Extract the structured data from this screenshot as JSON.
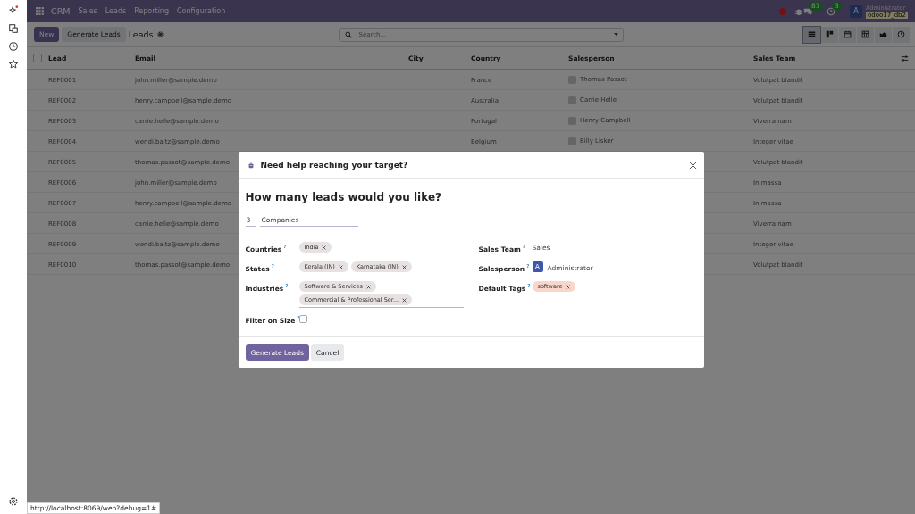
{
  "navbar": {
    "app": "CRM",
    "menus": [
      "Sales",
      "Leads",
      "Reporting",
      "Configuration"
    ],
    "messages_count": "83",
    "activities_count": "3",
    "user_initial": "A",
    "user_name": "Administrator",
    "database": "odoo17_db2"
  },
  "control_panel": {
    "new_button": "New",
    "generate_button": "Generate Leads",
    "breadcrumb": "Leads",
    "search": {
      "placeholder": "Search..."
    },
    "views": [
      {
        "kind": "list",
        "selected": true
      },
      {
        "kind": "kanban",
        "selected": false
      },
      {
        "kind": "calendar",
        "selected": false
      },
      {
        "kind": "pivot",
        "selected": false
      },
      {
        "kind": "graph",
        "selected": false
      },
      {
        "kind": "activity",
        "selected": false
      }
    ]
  },
  "table": {
    "select_all_checked": false,
    "columns": [
      "Lead",
      "Email",
      "City",
      "Country",
      "Salesperson",
      "Sales Team"
    ],
    "rows": [
      {
        "lead": "REF0001",
        "email": "john.miller@sample.demo",
        "country": "France",
        "salesperson": "Thomas Passot",
        "team": "Volutpat blandit"
      },
      {
        "lead": "REF0002",
        "email": "henry.campbell@sample.demo",
        "country": "Australia",
        "salesperson": "Carrie Helle",
        "team": "Volutpat blandit"
      },
      {
        "lead": "REF0003",
        "email": "carrie.helle@sample.demo",
        "country": "Portugal",
        "salesperson": "Henry Campbell",
        "team": "Viverra nam"
      },
      {
        "lead": "REF0004",
        "email": "wendi.baltz@sample.demo",
        "country": "Belgium",
        "salesperson": "Billy Lisker",
        "team": "Integer vitae"
      },
      {
        "lead": "REF0005",
        "email": "thomas.passot@sample.demo",
        "team": "Volutpat blandit"
      },
      {
        "lead": "REF0006",
        "email": "john.miller@sample.demo",
        "team": "In massa"
      },
      {
        "lead": "REF0007",
        "email": "henry.campbell@sample.demo",
        "team": "In massa"
      },
      {
        "lead": "REF0008",
        "email": "carrie.helle@sample.demo",
        "team": "Viverra nam"
      },
      {
        "lead": "REF0009",
        "email": "wendi.baltz@sample.demo",
        "team": "Integer vitae"
      },
      {
        "lead": "REF0010",
        "email": "thomas.passot@sample.demo",
        "team": "Volutpat blandit"
      }
    ]
  },
  "dialog": {
    "title": "Need help reaching your target?",
    "heading": "How many leads would you like?",
    "count": "3",
    "target": "Companies",
    "left_fields": [
      {
        "kind": "tags",
        "label": "Countries",
        "help": "?",
        "tags": [
          {
            "label": "India",
            "color": "#e7e1e1"
          }
        ]
      },
      {
        "kind": "tags",
        "label": "States",
        "help": "?",
        "tags": [
          {
            "label": "Kerala (IN)",
            "color": "#e7e1e1"
          },
          {
            "label": "Karnataka (IN)",
            "color": "#e7e1e1"
          }
        ]
      },
      {
        "kind": "tags",
        "label": "Industries",
        "help": "?",
        "underline": true,
        "tags": [
          {
            "label": "Software & Services",
            "color": "#e7e1e1"
          },
          {
            "label": "Commercial & Professional Ser...",
            "color": "#e7e1e1"
          }
        ]
      },
      {
        "kind": "checkbox",
        "label": "Filter on Size",
        "help": "?",
        "checked": false
      }
    ],
    "right_fields": [
      {
        "kind": "text",
        "label": "Sales Team",
        "help": "?",
        "value": "Sales"
      },
      {
        "kind": "user",
        "label": "Salesperson",
        "help": "?",
        "initial": "A",
        "value": "Administrator"
      },
      {
        "kind": "tags",
        "label": "Default Tags",
        "help": "?",
        "tags": [
          {
            "label": "software",
            "color": "#f9d6cb"
          }
        ]
      }
    ],
    "buttons": [
      {
        "label": "Generate Leads",
        "kind": "primary"
      },
      {
        "label": "Cancel",
        "kind": "secondary"
      }
    ]
  },
  "status_url": "http://localhost:8069/web?debug=1#"
}
